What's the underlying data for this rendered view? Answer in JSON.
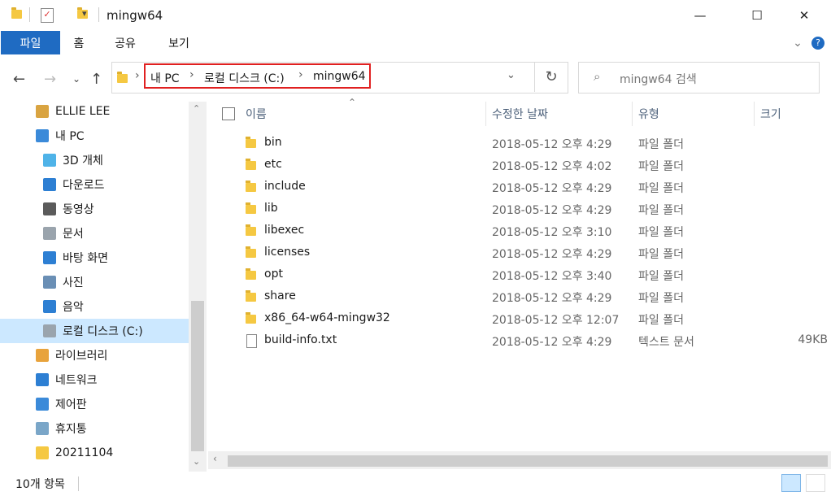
{
  "window": {
    "title": "mingw64",
    "minimize": "—",
    "maximize": "☐",
    "close": "✕"
  },
  "ribbon": {
    "tabs": [
      "파일",
      "홈",
      "공유",
      "보기"
    ],
    "expand": "⌄",
    "help": "?"
  },
  "address": {
    "crumbs": [
      "내 PC",
      "로컬 디스크 (C:)",
      "mingw64"
    ],
    "search_placeholder": "mingw64 검색"
  },
  "sidebar": {
    "items": [
      {
        "label": "ELLIE LEE",
        "icon": "user-folder-icon",
        "color": "#d9a441"
      },
      {
        "label": "내 PC",
        "icon": "pc-icon",
        "color": "#3b8ad9"
      },
      {
        "label": "3D 개체",
        "icon": "3d-objects-icon",
        "color": "#4fb3e8"
      },
      {
        "label": "다운로드",
        "icon": "download-icon",
        "color": "#2d7fd3"
      },
      {
        "label": "동영상",
        "icon": "video-icon",
        "color": "#5b5b5b"
      },
      {
        "label": "문서",
        "icon": "document-icon",
        "color": "#9aa4ad"
      },
      {
        "label": "바탕 화면",
        "icon": "desktop-icon",
        "color": "#2d7fd3"
      },
      {
        "label": "사진",
        "icon": "pictures-icon",
        "color": "#6a8fb5"
      },
      {
        "label": "음악",
        "icon": "music-icon",
        "color": "#2d7fd3"
      },
      {
        "label": "로컬 디스크 (C:)",
        "icon": "drive-icon",
        "color": "#9aa4ad"
      },
      {
        "label": "라이브러리",
        "icon": "library-icon",
        "color": "#e8a33c"
      },
      {
        "label": "네트워크",
        "icon": "network-icon",
        "color": "#2d7fd3"
      },
      {
        "label": "제어판",
        "icon": "control-panel-icon",
        "color": "#3b8ad9"
      },
      {
        "label": "휴지통",
        "icon": "recycle-bin-icon",
        "color": "#7aa6c8"
      },
      {
        "label": "20211104",
        "icon": "folder-icon",
        "color": "#f5c842"
      }
    ]
  },
  "columns": {
    "name": "이름",
    "date": "수정한 날짜",
    "type": "유형",
    "size": "크기"
  },
  "files": [
    {
      "name": "bin",
      "date": "2018-05-12 오후 4:29",
      "type": "파일 폴더",
      "size": ""
    },
    {
      "name": "etc",
      "date": "2018-05-12 오후 4:02",
      "type": "파일 폴더",
      "size": ""
    },
    {
      "name": "include",
      "date": "2018-05-12 오후 4:29",
      "type": "파일 폴더",
      "size": ""
    },
    {
      "name": "lib",
      "date": "2018-05-12 오후 4:29",
      "type": "파일 폴더",
      "size": ""
    },
    {
      "name": "libexec",
      "date": "2018-05-12 오후 3:10",
      "type": "파일 폴더",
      "size": ""
    },
    {
      "name": "licenses",
      "date": "2018-05-12 오후 4:29",
      "type": "파일 폴더",
      "size": ""
    },
    {
      "name": "opt",
      "date": "2018-05-12 오후 3:40",
      "type": "파일 폴더",
      "size": ""
    },
    {
      "name": "share",
      "date": "2018-05-12 오후 4:29",
      "type": "파일 폴더",
      "size": ""
    },
    {
      "name": "x86_64-w64-mingw32",
      "date": "2018-05-12 오후 12:07",
      "type": "파일 폴더",
      "size": ""
    },
    {
      "name": "build-info.txt",
      "date": "2018-05-12 오후 4:29",
      "type": "텍스트 문서",
      "size": "49KB"
    }
  ],
  "status": {
    "count": "10개 항목"
  },
  "colors": {
    "accent": "#1f6bc2",
    "highlight": "#e02020",
    "selected": "#cce8ff"
  }
}
